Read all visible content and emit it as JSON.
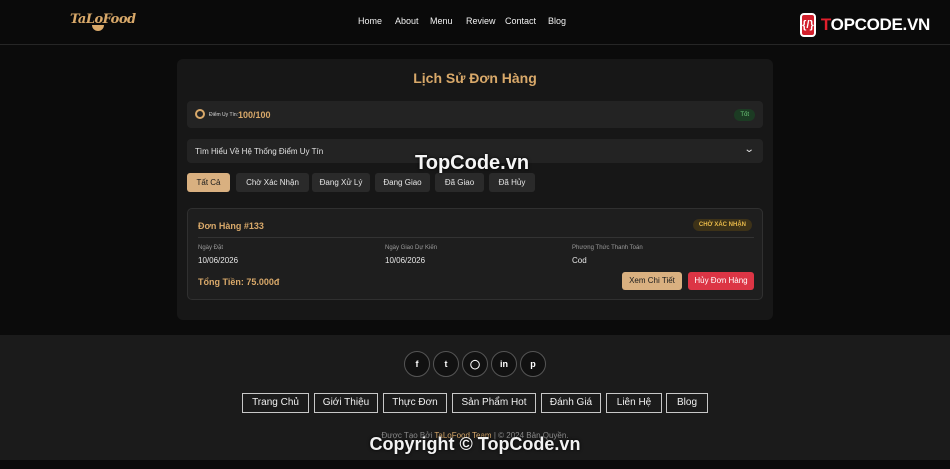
{
  "header": {
    "logo_text": "TaLoFood",
    "nav": [
      "Home",
      "About",
      "Menu",
      "Review",
      "Contact",
      "Blog"
    ],
    "watermark_icon": "{/}",
    "watermark_brand_a": "T",
    "watermark_brand_b": "OPCODE.VN"
  },
  "history": {
    "title": "Lịch Sử Đơn Hàng",
    "trust_label": "Điểm Uy Tín:",
    "trust_score": "100/100",
    "trust_badge": "Tốt",
    "learn_label": "Tìm Hiểu Về Hệ Thống Điểm Uy Tín",
    "tabs": [
      "Tất Cả",
      "Chờ Xác Nhận",
      "Đang Xử Lý",
      "Đang Giao",
      "Đã Giao",
      "Đã Hủy"
    ],
    "active_tab": "Tất Cả"
  },
  "order": {
    "title": "Đơn Hàng #133",
    "status": "CHỜ XÁC NHẬN",
    "order_date_label": "Ngày Đặt",
    "order_date": "10/06/2026",
    "delivery_label": "Ngày Giao Dự Kiến",
    "delivery_date": "10/06/2026",
    "payment_label": "Phương Thức Thanh Toán",
    "payment": "Cod",
    "total": "Tổng Tiền: 75.000đ",
    "detail_button": "Xem Chi Tiết",
    "cancel_button": "Hủy Đơn Hàng"
  },
  "watermark_center": "TopCode.vn",
  "footer": {
    "social": [
      "facebook-icon",
      "twitter-icon",
      "instagram-icon",
      "linkedin-icon",
      "pinterest-icon"
    ],
    "links": [
      "Trang Chủ",
      "Giới Thiệu",
      "Thực Đơn",
      "Sản Phẩm Hot",
      "Đánh Giá",
      "Liên Hệ",
      "Blog"
    ],
    "credit_prefix": "Được Tạo Bởi",
    "credit_brand": "TaLoFood Team",
    "credit_suffix": "| © 2024 Bản Quyền.",
    "watermark": "Copyright © TopCode.vn"
  },
  "colors": {
    "accent": "#d9a96a",
    "danger": "#dc3545",
    "success": "#6fce7c",
    "warning": "#e8b949"
  }
}
